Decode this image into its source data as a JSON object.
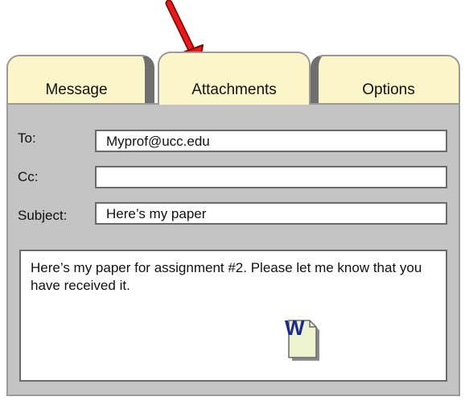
{
  "tabs": [
    {
      "label": "Message"
    },
    {
      "label": "Attachments"
    },
    {
      "label": "Options"
    }
  ],
  "fields": {
    "to": {
      "label": "To:",
      "value": "Myprof@ucc.edu"
    },
    "cc": {
      "label": "Cc:",
      "value": ""
    },
    "subject": {
      "label": "Subject:",
      "value": "Here’s my paper"
    }
  },
  "body": {
    "text": "Here’s my paper for assignment #2.  Please let me know that you have received it."
  },
  "attachment": {
    "icon": "word-document-icon",
    "letter": "W"
  },
  "colors": {
    "tab": "#fbf6c9",
    "panel": "#c4c4c4",
    "arrow": "#e8191b",
    "doc_letter": "#1b2a8c"
  }
}
